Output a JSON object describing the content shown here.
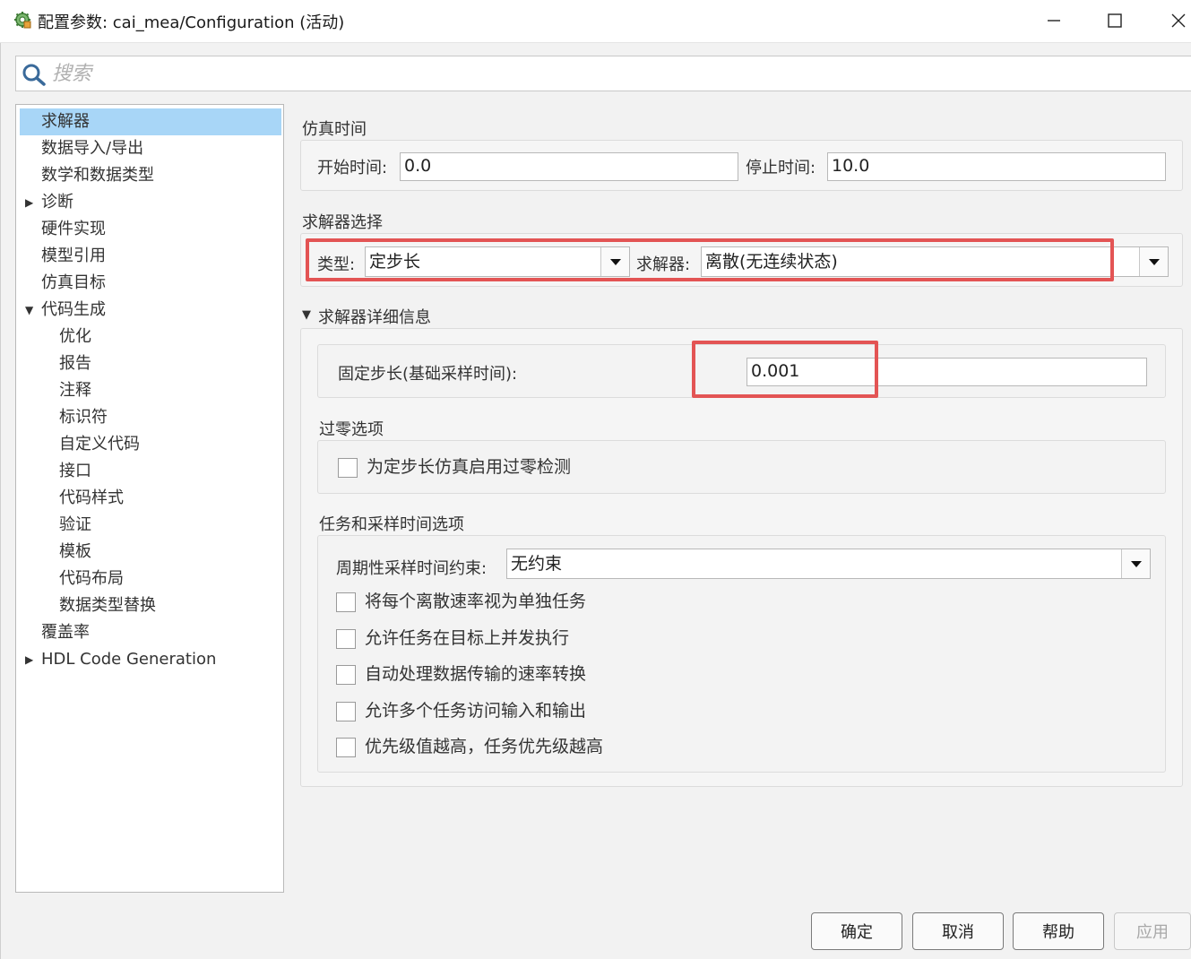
{
  "window": {
    "title": "配置参数: cai_mea/Configuration (活动)",
    "icon": "gear-model-icon",
    "controls": [
      "minimize-icon",
      "maximize-icon",
      "close-icon"
    ]
  },
  "search": {
    "placeholder": "搜索",
    "value": ""
  },
  "tree": {
    "items": [
      {
        "label": "求解器",
        "selected": true
      },
      {
        "label": "数据导入/导出"
      },
      {
        "label": "数学和数据类型"
      },
      {
        "label": "诊断",
        "expander": "collapsed"
      },
      {
        "label": "硬件实现"
      },
      {
        "label": "模型引用"
      },
      {
        "label": "仿真目标"
      },
      {
        "label": "代码生成",
        "expander": "expanded"
      },
      {
        "label": "优化"
      },
      {
        "label": "报告"
      },
      {
        "label": "注释"
      },
      {
        "label": "标识符"
      },
      {
        "label": "自定义代码"
      },
      {
        "label": "接口"
      },
      {
        "label": "代码样式"
      },
      {
        "label": "验证"
      },
      {
        "label": "模板"
      },
      {
        "label": "代码布局"
      },
      {
        "label": "数据类型替换"
      },
      {
        "label": "覆盖率"
      },
      {
        "label": "HDL Code Generation",
        "expander": "collapsed"
      }
    ]
  },
  "sim_time": {
    "title": "仿真时间",
    "start_label": "开始时间:",
    "start_value": "0.0",
    "stop_label": "停止时间:",
    "stop_value": "10.0"
  },
  "solver_select": {
    "title": "求解器选择",
    "type_label": "类型:",
    "type_value": "定步长",
    "solver_label": "求解器:",
    "solver_value": "离散(无连续状态)"
  },
  "solver_details": {
    "title": "求解器详细信息",
    "fixed_step_label": "固定步长(基础采样时间):",
    "fixed_step_value": "0.001",
    "zero_crossing": {
      "title": "过零选项",
      "checkbox": {
        "label": "为定步长仿真启用过零检测",
        "checked": false
      }
    },
    "tasking": {
      "title": "任务和采样时间选项",
      "periodic_label": "周期性采样时间约束:",
      "periodic_value": "无约束",
      "checkboxes": [
        {
          "label": "将每个离散速率视为单独任务",
          "checked": false
        },
        {
          "label": "允许任务在目标上并发执行",
          "checked": false
        },
        {
          "label": "自动处理数据传输的速率转换",
          "checked": false
        },
        {
          "label": "允许多个任务访问输入和输出",
          "checked": false
        },
        {
          "label": "优先级值越高，任务优先级越高",
          "checked": false
        }
      ]
    }
  },
  "buttons": {
    "ok": "确定",
    "cancel": "取消",
    "help": "帮助",
    "apply": "应用"
  },
  "colors": {
    "selection": "#a8d6f7",
    "highlight_box": "#e35454"
  }
}
